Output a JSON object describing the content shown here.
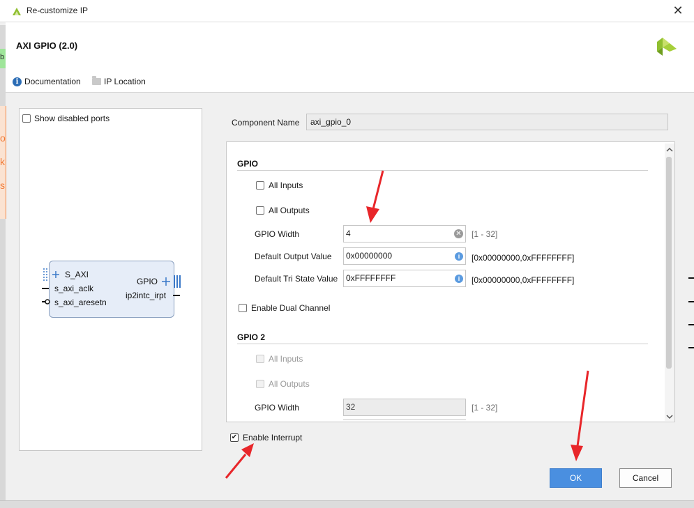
{
  "window": {
    "title": "Re-customize IP",
    "close_glyph": "✕"
  },
  "header": {
    "ip_title": "AXI GPIO (2.0)",
    "documentation_label": "Documentation",
    "ip_location_label": "IP Location",
    "brand_color": "#9acd32"
  },
  "backdrop": {
    "char_b": "b",
    "char_k": "k",
    "char_s": "s"
  },
  "left_panel": {
    "show_disabled_ports": {
      "label": "Show disabled ports",
      "checked": false
    },
    "ip_block": {
      "left_ports": [
        "S_AXI",
        "s_axi_aclk",
        "s_axi_aresetn"
      ],
      "right_ports": [
        "GPIO",
        "ip2intc_irpt"
      ]
    }
  },
  "form": {
    "component_name_label": "Component Name",
    "component_name_value": "axi_gpio_0",
    "gpio": {
      "title": "GPIO",
      "all_inputs": {
        "label": "All Inputs",
        "checked": false
      },
      "all_outputs": {
        "label": "All Outputs",
        "checked": false
      },
      "width_label": "GPIO Width",
      "width_value": "4",
      "width_range": "[1 - 32]",
      "default_output_label": "Default Output Value",
      "default_output_value": "0x00000000",
      "default_output_range": "[0x00000000,0xFFFFFFFF]",
      "default_tri_label": "Default Tri State Value",
      "default_tri_value": "0xFFFFFFFF",
      "default_tri_range": "[0x00000000,0xFFFFFFFF]"
    },
    "enable_dual_channel": {
      "label": "Enable Dual Channel",
      "checked": false
    },
    "gpio2": {
      "title": "GPIO 2",
      "all_inputs": {
        "label": "All Inputs",
        "checked": false,
        "disabled": true
      },
      "all_outputs": {
        "label": "All Outputs",
        "checked": false,
        "disabled": true
      },
      "width_label": "GPIO Width",
      "width_value": "32",
      "width_range": "[1 - 32]"
    },
    "enable_interrupt": {
      "label": "Enable Interrupt",
      "checked": true
    }
  },
  "buttons": {
    "ok": "OK",
    "cancel": "Cancel"
  },
  "annotation_color": "#e8262a"
}
